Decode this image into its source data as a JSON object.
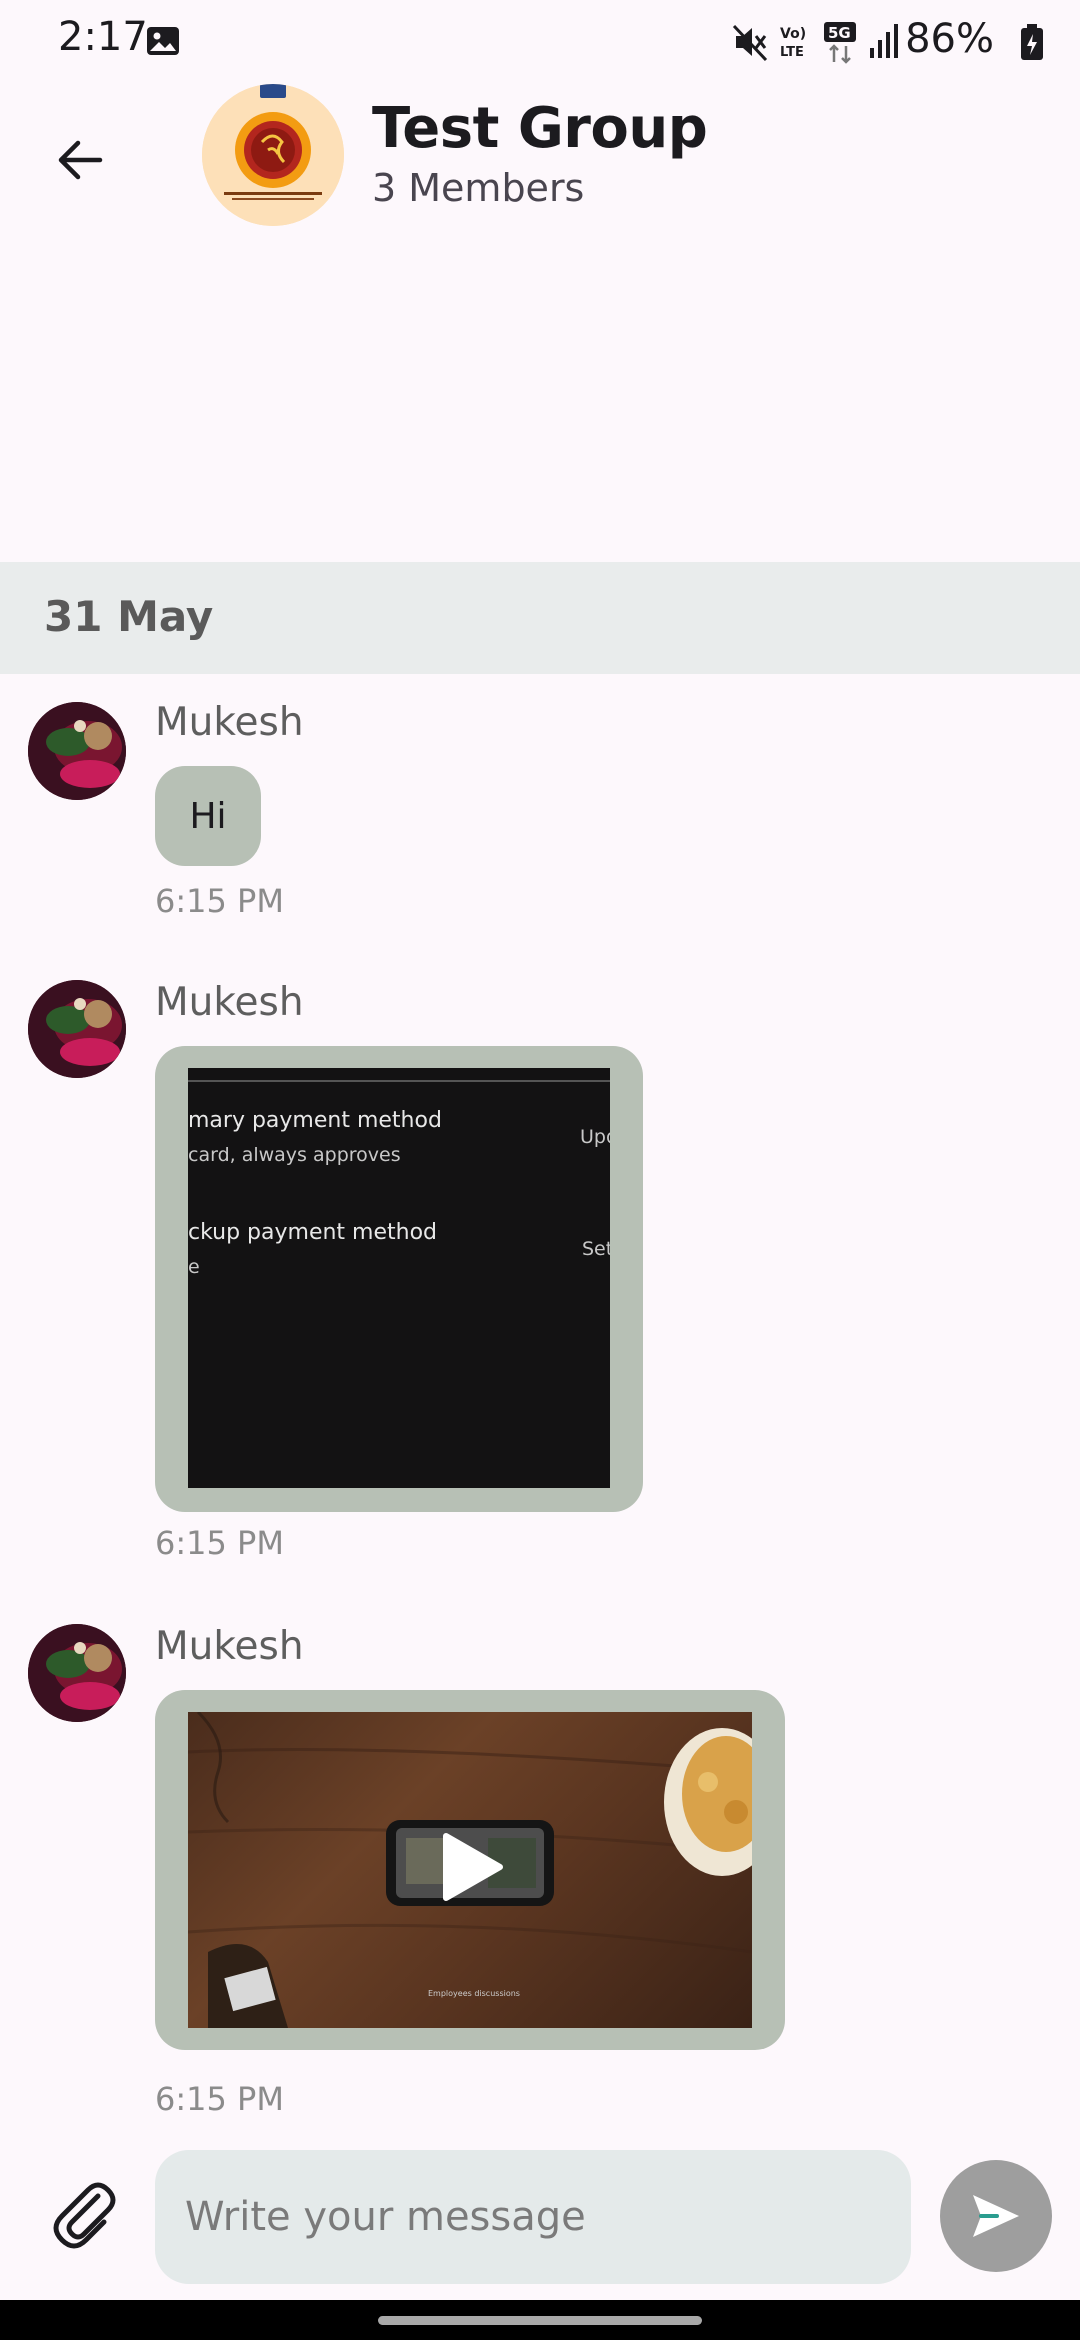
{
  "status_bar": {
    "time": "2:17",
    "battery": "86%",
    "icons": [
      "gallery-icon",
      "mute-icon",
      "volte-icon",
      "5g-icon",
      "signal-icon",
      "battery-icon"
    ]
  },
  "header": {
    "title": "Test Group",
    "members": "3 Members",
    "icons": [
      "back-arrow-icon",
      "group-avatar"
    ]
  },
  "date_separator": "31 May",
  "messages": [
    {
      "sender": "Mukesh",
      "type": "text",
      "text": "Hi",
      "time": "6:15 PM"
    },
    {
      "sender": "Mukesh",
      "type": "image",
      "time": "6:15 PM",
      "image_text": {
        "line1": "mary payment method",
        "line2": "card, always approves",
        "line3": "ckup payment method",
        "line4": "e",
        "right1": "Upd",
        "right2": "Set"
      }
    },
    {
      "sender": "Mukesh",
      "type": "video",
      "time": "6:15 PM",
      "icon": "play-icon"
    }
  ],
  "composer": {
    "placeholder": "Write your message",
    "icons": [
      "paperclip-icon",
      "send-icon"
    ]
  },
  "colors": {
    "background": "#fdf8fc",
    "bubble": "#b7c0b5",
    "date_bar": "#e9ecec",
    "input": "#e4eaea",
    "send_button": "#9e9e9e"
  }
}
